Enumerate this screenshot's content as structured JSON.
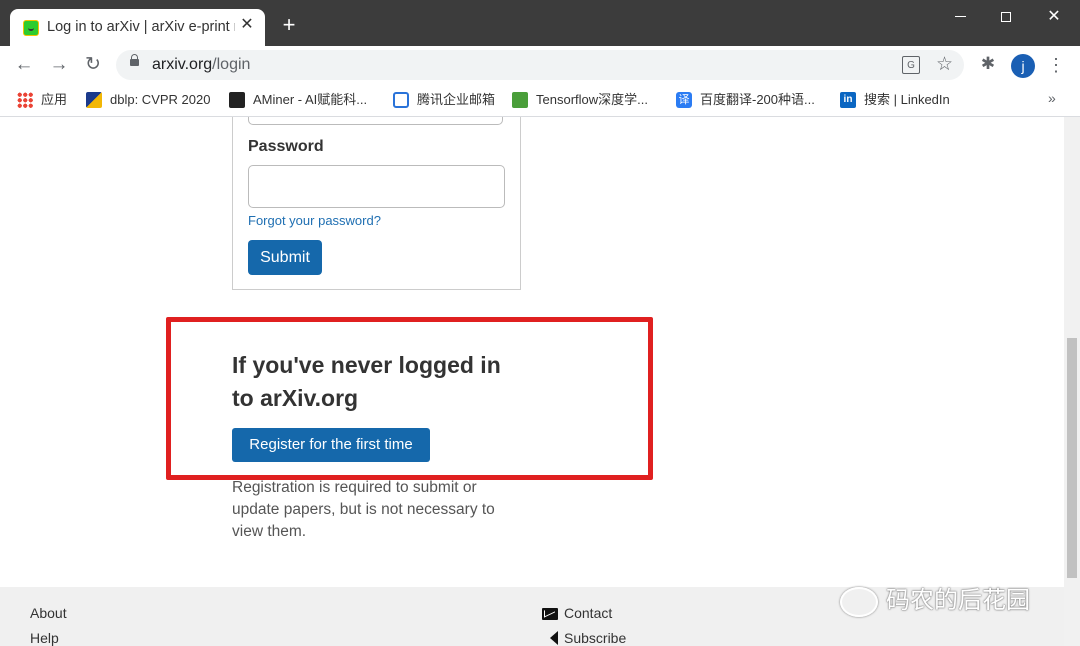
{
  "browser": {
    "tab_title": "Log in to arXiv | arXiv e-print r",
    "tab_close": "✕",
    "new_tab": "+",
    "url_host": "arxiv.org",
    "url_path": "/login",
    "profile_initial": "j"
  },
  "bookmarks": [
    {
      "label": "应用",
      "icon": "apps-grid-icon"
    },
    {
      "label": "dblp: CVPR 2020",
      "icon": "dblp-icon"
    },
    {
      "label": "AMiner - AI赋能科...",
      "icon": "aminer-icon"
    },
    {
      "label": "腾讯企业邮箱",
      "icon": "tencent-mail-icon"
    },
    {
      "label": "Tensorflow深度学...",
      "icon": "tensorflow-icon"
    },
    {
      "label": "百度翻译-200种语...",
      "icon": "baidu-translate-icon"
    },
    {
      "label": "搜索 | LinkedIn",
      "icon": "linkedin-icon"
    }
  ],
  "login": {
    "password_label": "Password",
    "forgot_link": "Forgot your password?",
    "submit_label": "Submit"
  },
  "register": {
    "heading_line1": "If you've never logged in",
    "heading_line2": "to arXiv.org",
    "button_label": "Register for the first time",
    "note": "Registration is required to submit or update papers, but is not necessary to view them."
  },
  "footer": {
    "about": "About",
    "help": "Help",
    "contact": "Contact",
    "subscribe": "Subscribe"
  },
  "watermark": "码农的后花园",
  "colors": {
    "accent": "#1568ab",
    "highlight_box": "#e02020"
  }
}
